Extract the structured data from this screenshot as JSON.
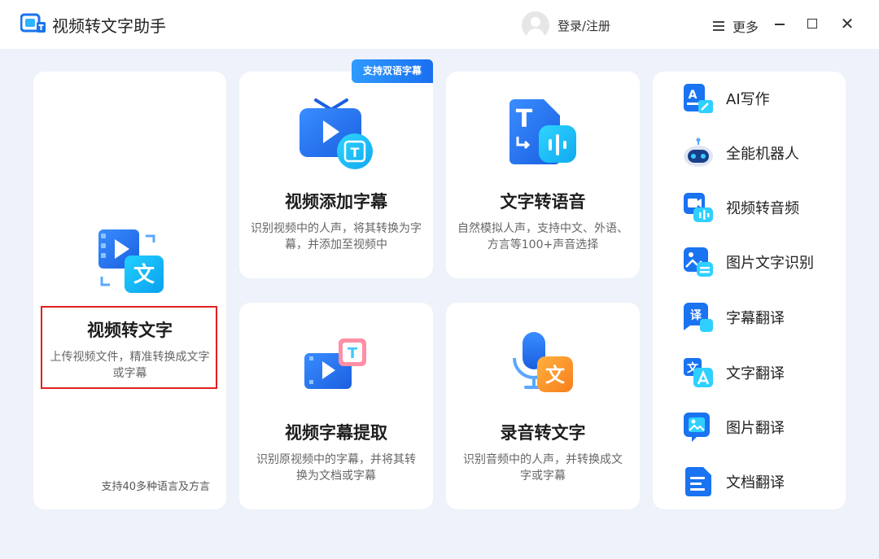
{
  "app": {
    "title": "视频转文字助手",
    "login_label": "登录/注册",
    "more_label": "更多",
    "close_glyph": "✕"
  },
  "colors": {
    "accent": "#1a73f0",
    "highlight_border": "#e02020",
    "background": "#eef2fa"
  },
  "main_card": {
    "title": "视频转文字",
    "description": "上传视频文件，精准转换成文字或字幕",
    "foot_note": "支持40多种语言及方言",
    "icon": "video-to-text-icon",
    "icon_text": "文"
  },
  "cards": {
    "subtitle": {
      "badge": "支持双语字幕",
      "title": "视频添加字幕",
      "description": "识别视频中的人声，将其转换为字幕，并添加至视频中",
      "icon": "tv-subtitle-icon",
      "icon_text": "T"
    },
    "tts": {
      "title": "文字转语音",
      "description": "自然模拟人声，支持中文、外语、方言等100+声音选择",
      "icon": "text-to-speech-icon",
      "icon_text": "T"
    },
    "extract": {
      "title": "视频字幕提取",
      "description": "识别原视频中的字幕，并将其转换为文档或字幕",
      "icon": "subtitle-extract-icon",
      "icon_text": "T"
    },
    "record": {
      "title": "录音转文字",
      "description": "识别音频中的人声，并转换成文字或字幕",
      "icon": "microphone-icon",
      "icon_text": "文"
    }
  },
  "side_items": [
    {
      "label": "AI写作",
      "icon": "ai-writing-icon",
      "glyph": "A"
    },
    {
      "label": "全能机器人",
      "icon": "robot-icon",
      "glyph": ""
    },
    {
      "label": "视频转音频",
      "icon": "video-to-audio-icon",
      "glyph": ""
    },
    {
      "label": "图片文字识别",
      "icon": "image-ocr-icon",
      "glyph": ""
    },
    {
      "label": "字幕翻译",
      "icon": "subtitle-translate-icon",
      "glyph": "译"
    },
    {
      "label": "文字翻译",
      "icon": "text-translate-icon",
      "glyph": "文"
    },
    {
      "label": "图片翻译",
      "icon": "image-translate-icon",
      "glyph": ""
    },
    {
      "label": "文档翻译",
      "icon": "document-translate-icon",
      "glyph": ""
    }
  ]
}
